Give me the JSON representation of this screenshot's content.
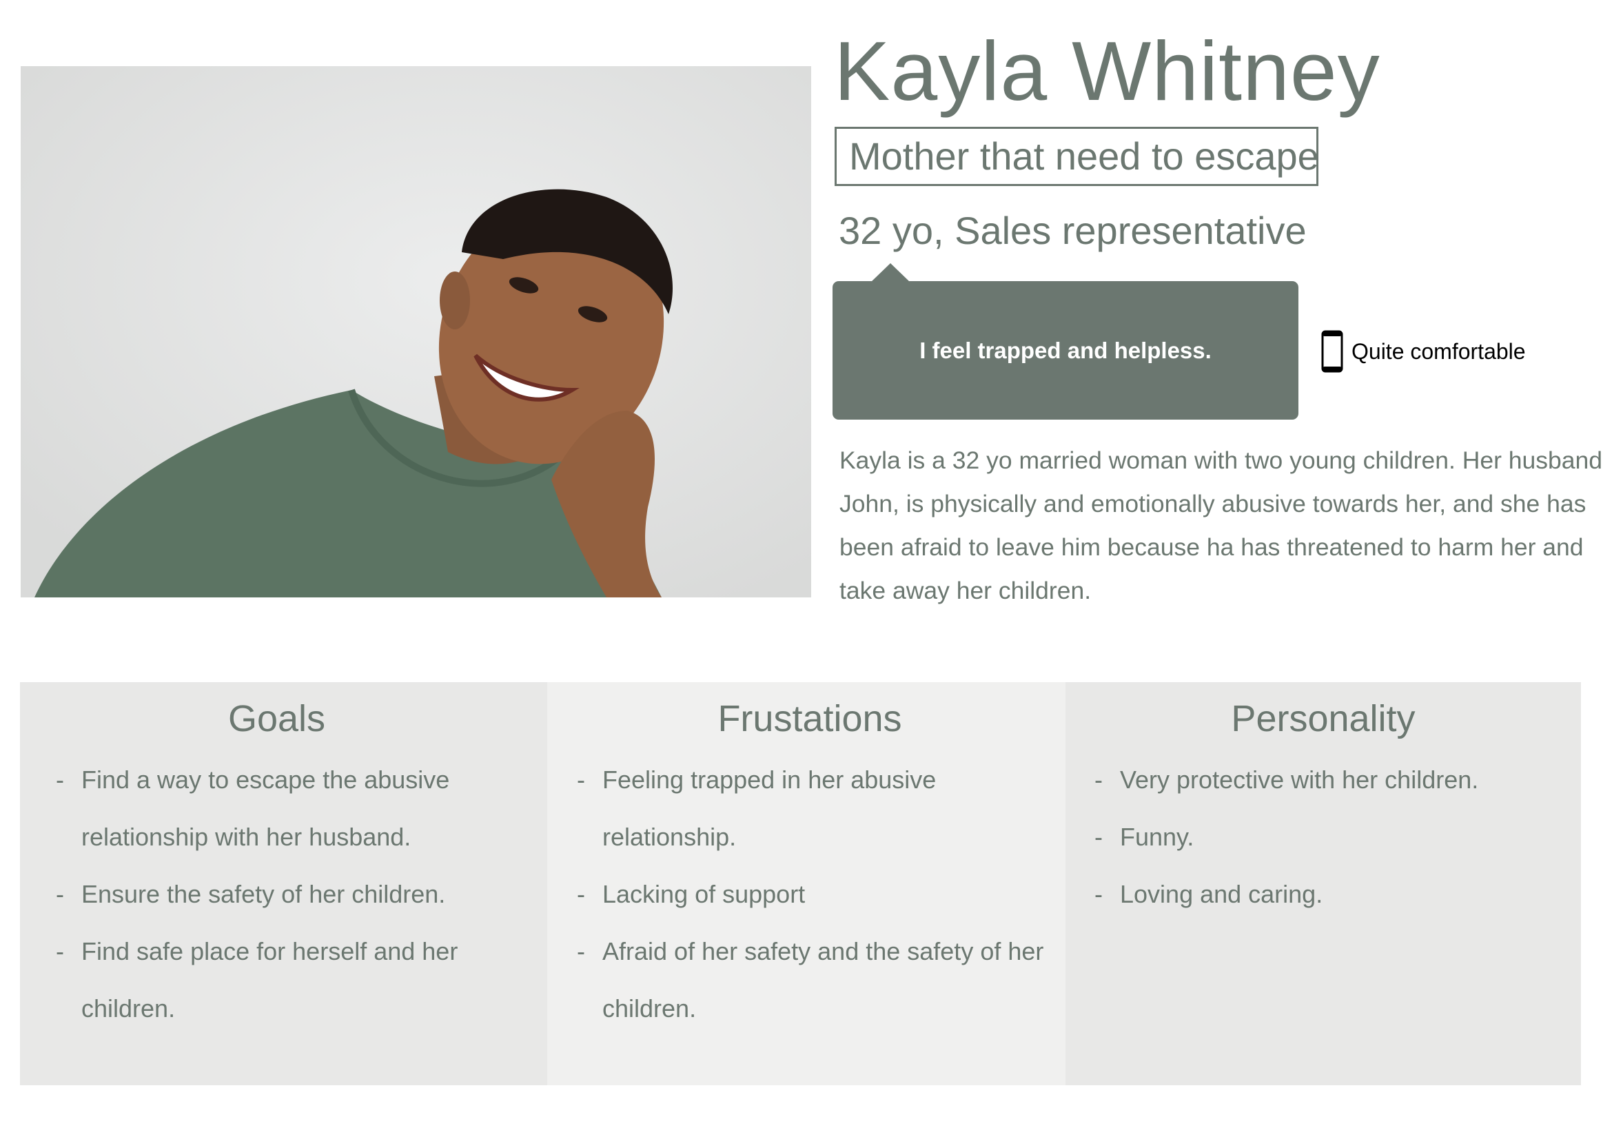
{
  "persona": {
    "name": "Kayla Whitney",
    "tagline": "Mother that need to escape",
    "age_occupation": "32 yo, Sales representative",
    "quote": "I feel trapped and helpless.",
    "device": {
      "icon": "smartphone-icon",
      "label": "Quite comfortable"
    },
    "bio": "Kayla is a 32 yo married woman with two young children. Her husband John, is physically and emotionally abusive towards her, and she has been afraid to leave him because ha has threatened to harm her and take away her children."
  },
  "sections": {
    "goals": {
      "title": "Goals",
      "items": [
        "Find a way to escape the abusive relationship with her husband.",
        "Ensure the safety of her children.",
        "Find safe place for herself and her children."
      ]
    },
    "frustrations": {
      "title": "Frustations",
      "items": [
        "Feeling trapped in her abusive relationship.",
        "Lacking of support",
        "Afraid of her safety and the safety of her children."
      ]
    },
    "personality": {
      "title": "Personality",
      "items": [
        "Very protective with her children.",
        "Funny.",
        "Loving and caring."
      ]
    }
  },
  "colors": {
    "accent": "#6b7770",
    "panel_dark": "#e8e8e7",
    "panel_light": "#f0f0ef",
    "quote_text": "#ffffff"
  },
  "dash": "-"
}
